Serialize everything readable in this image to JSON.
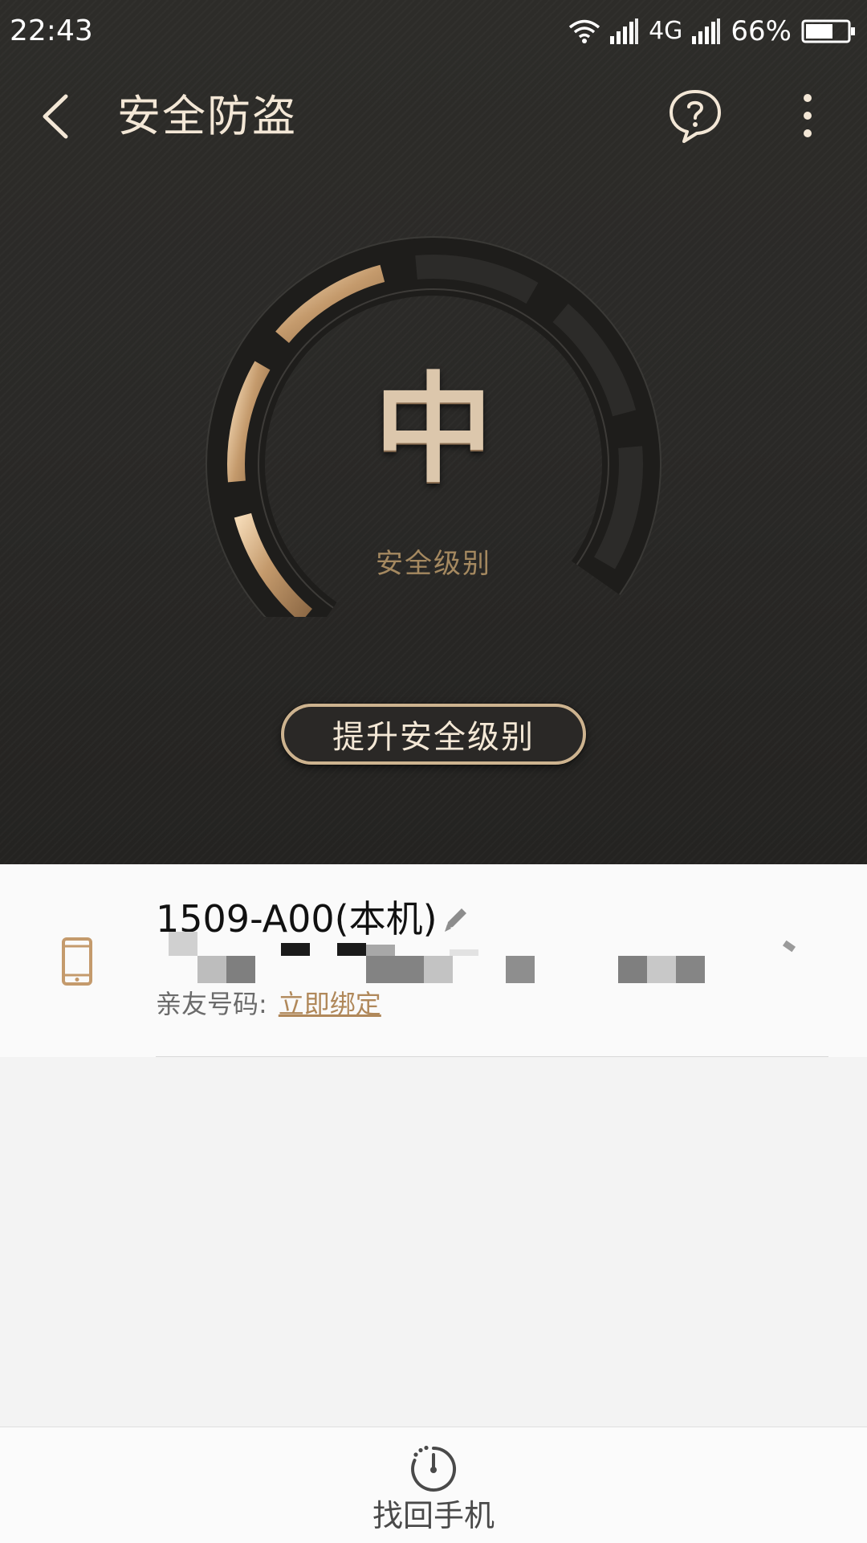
{
  "status_bar": {
    "time": "22:43",
    "network": "4G",
    "battery": "66%",
    "battery_level": 0.66
  },
  "app_bar": {
    "title": "安全防盗",
    "back_icon": "chevron-left-icon",
    "help_icon": "help-bubble-icon",
    "more_icon": "more-vertical-icon"
  },
  "gauge": {
    "level": "中",
    "label": "安全级别",
    "segments_total": 6,
    "segments_active": 3
  },
  "upgrade_button": {
    "label": "提升安全级别"
  },
  "device": {
    "name": "1509-A00(本机)",
    "contact_label": "亲友号码:",
    "contact_action": "立即绑定"
  },
  "bottom_bar": {
    "find_phone_label": "找回手机"
  },
  "colors": {
    "dark_bg": "#2b2a28",
    "gold_accent": "#cdb38f",
    "gold_text": "#a58960",
    "link_gold": "#b0885a"
  }
}
